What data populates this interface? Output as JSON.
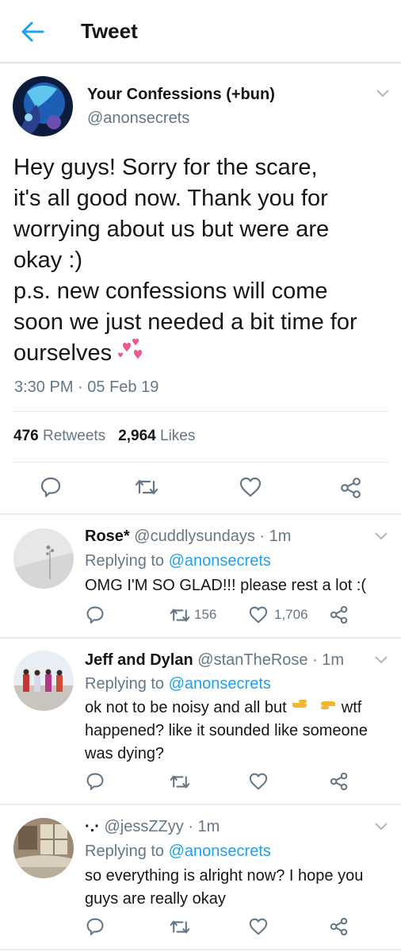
{
  "header": {
    "title": "Tweet",
    "back_icon": "arrow-left-icon",
    "accent": "#1da1f2"
  },
  "tweet": {
    "name": "Your Confessions (+bun)",
    "handle": "@anonsecrets",
    "text": "Hey guys! Sorry for the scare,\nit's all good now. Thank you for\nworrying about us but were are\nokay :)\np.s. new confessions will come\nsoon we just needed a bit time for\nourselves",
    "emoji_icon": "revolving-hearts-emoji",
    "time": "3:30 PM",
    "date_sep": " · ",
    "date": "05 Feb 19",
    "retweets": "476",
    "retweets_label": "Retweets",
    "likes": "2,964",
    "likes_label": "Likes"
  },
  "replies": [
    {
      "name": "Rose*",
      "handle": "@cuddlysundays",
      "time": " · 1m",
      "replying_label": "Replying to ",
      "replying_to": "@anonsecrets",
      "text": "OMG I'M SO GLAD!!! please rest a lot :(",
      "retweets": "156",
      "likes": "1,706"
    },
    {
      "name": "Jeff and Dylan",
      "handle": "@stanTheRose",
      "time": " · 1m",
      "replying_label": "Replying to ",
      "replying_to": "@anonsecrets",
      "text_before_emoji": "ok not to be noisy and all but ",
      "emoji_icon": "pointing-hands-emoji",
      "text_after_emoji": " wtf",
      "text_rest": "happened? like it sounded like someone\nwas dying?"
    },
    {
      "name": "·.·",
      "handle": "@jessZZyy",
      "time": " · 1m",
      "replying_label": "Replying to ",
      "replying_to": "@anonsecrets",
      "text": "so everything is alright now? I hope you\nguys are really okay"
    }
  ]
}
